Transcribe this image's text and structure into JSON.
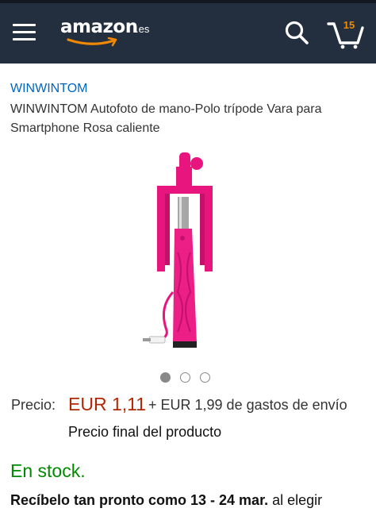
{
  "header": {
    "logo_text": "amazon",
    "logo_tld": ".es",
    "cart_count": "15",
    "icons": {
      "menu": "hamburger-icon",
      "search": "search-icon",
      "cart": "cart-icon"
    },
    "colors": {
      "bar": "#232f3e",
      "accent": "#f08804"
    }
  },
  "product": {
    "brand": "WINWINTOM",
    "title": "WINWINTOM Autofoto de mano-Polo trípode Vara para Smartphone Rosa caliente",
    "image_dots": {
      "count": 3,
      "active_index": 0
    }
  },
  "pricing": {
    "label": "Precio:",
    "price": "EUR 1,11",
    "shipping": "+ EUR 1,99 de gastos de envío",
    "final_note": "Precio final del producto"
  },
  "availability": {
    "stock_text": "En stock."
  },
  "delivery": {
    "bold_text": "Recíbelo tan pronto como 13 - 24 mar.",
    "rest_text": " al elegir"
  }
}
